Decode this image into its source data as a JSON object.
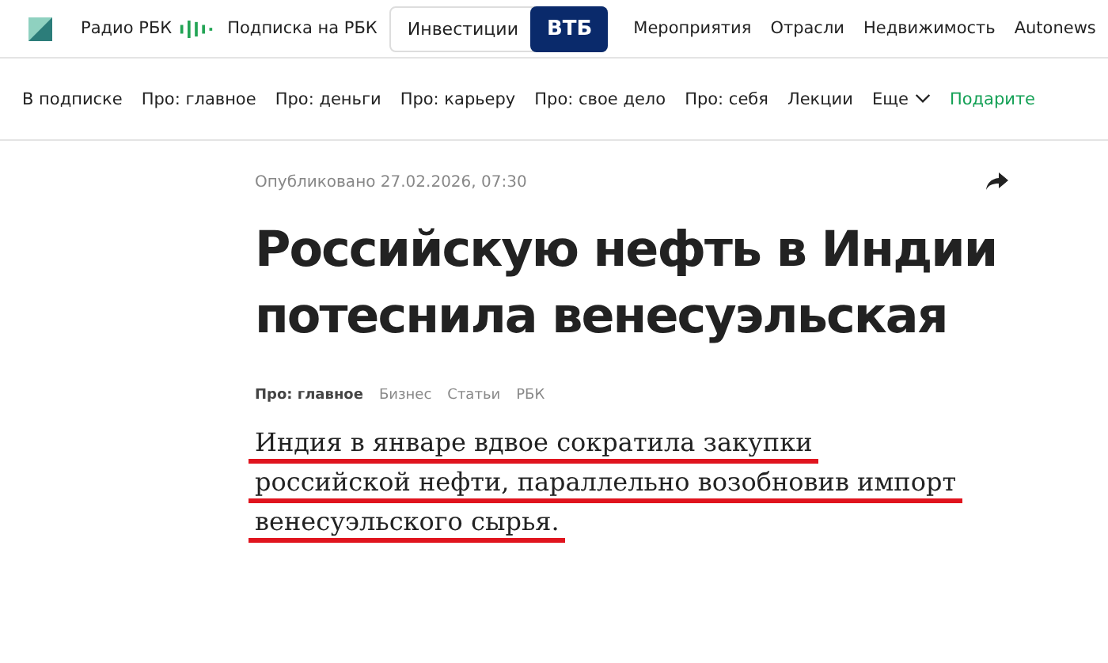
{
  "top_bar": {
    "radio": "Радио РБК",
    "subscription": "Подписка на РБК",
    "partner": {
      "label": "Инвестиции",
      "badge": "ВТБ"
    },
    "links": [
      "Мероприятия",
      "Отрасли",
      "Недвижимость",
      "Autonews"
    ]
  },
  "sub_nav": {
    "items": [
      {
        "label": "В подписке",
        "kind": "link"
      },
      {
        "label": "Про: главное",
        "kind": "link"
      },
      {
        "label": "Про: деньги",
        "kind": "link"
      },
      {
        "label": "Про: карьеру",
        "kind": "link"
      },
      {
        "label": "Про: свое дело",
        "kind": "link"
      },
      {
        "label": "Про: себя",
        "kind": "link"
      },
      {
        "label": "Лекции",
        "kind": "link"
      },
      {
        "label": "Еще",
        "kind": "dropdown"
      },
      {
        "label": "Подарите",
        "kind": "accent"
      }
    ]
  },
  "article": {
    "published": "Опубликовано 27.02.2026, 07:30",
    "headline": "Российскую нефть в Индии потеснила венесуэльская",
    "tags": [
      {
        "label": "Про: главное",
        "selected": true
      },
      {
        "label": "Бизнес",
        "selected": false
      },
      {
        "label": "Статьи",
        "selected": false
      },
      {
        "label": "РБК",
        "selected": false
      }
    ],
    "lead_lines": [
      "Индия в январе вдвое сократила закупки",
      "российской нефти, параллельно возобновив импорт",
      "венесуэльского сырья."
    ]
  }
}
